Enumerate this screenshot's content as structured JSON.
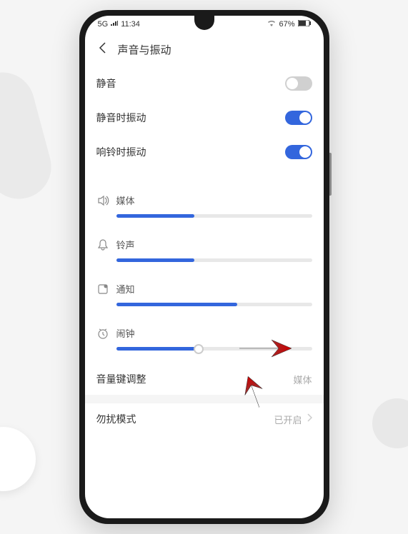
{
  "status_bar": {
    "time": "11:34",
    "signal": "5G",
    "battery_percent": "67%"
  },
  "header": {
    "title": "声音与振动"
  },
  "toggles": {
    "mute": {
      "label": "静音",
      "on": false
    },
    "vibrate_mute": {
      "label": "静音时振动",
      "on": true
    },
    "vibrate_ring": {
      "label": "响铃时振动",
      "on": true
    }
  },
  "sliders": {
    "media": {
      "label": "媒体",
      "value": 40
    },
    "ringtone": {
      "label": "铃声",
      "value": 40
    },
    "notification": {
      "label": "通知",
      "value": 62
    },
    "alarm": {
      "label": "闹钟",
      "value": 42
    }
  },
  "volume_key": {
    "label": "音量键调整",
    "value": "媒体"
  },
  "dnd": {
    "label": "勿扰模式",
    "value": "已开启"
  }
}
